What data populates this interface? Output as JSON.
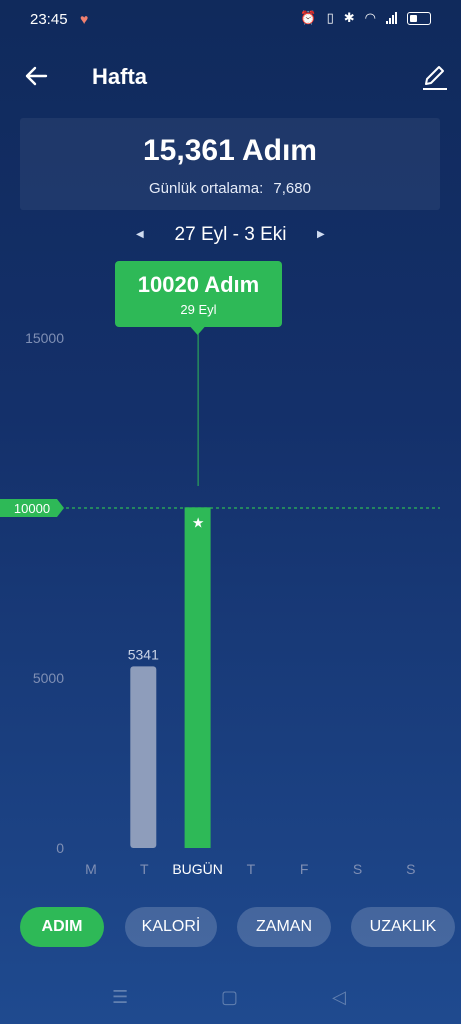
{
  "status_bar": {
    "time": "23:45",
    "battery_pct": 35
  },
  "header": {
    "title": "Hafta"
  },
  "summary": {
    "total": "15,361 Adım",
    "average_label": "Günlük ortalama:",
    "average_value": "7,680"
  },
  "range": {
    "label": "27 Eyl - 3 Eki"
  },
  "tooltip": {
    "value": "10020 Adım",
    "date": "29 Eyl"
  },
  "goal": {
    "label": "10000"
  },
  "chart_data": {
    "type": "bar",
    "categories": [
      "M",
      "T",
      "BUGÜN",
      "T",
      "F",
      "S",
      "S"
    ],
    "values": [
      0,
      5341,
      10020,
      0,
      0,
      0,
      0
    ],
    "data_labels": [
      "",
      "5341",
      "",
      "",
      "",
      "",
      ""
    ],
    "y_ticks": [
      "0",
      "5000",
      "10000",
      "15000"
    ],
    "ylim": [
      0,
      15000
    ],
    "goal": 10000,
    "highlight_index": 2,
    "colors": {
      "normal": "#8e9dbb",
      "highlight": "#2eb957",
      "goal_line": "#2eb957",
      "tick": "#7f8fb4"
    }
  },
  "tabs": [
    {
      "label": "ADIM",
      "active": true
    },
    {
      "label": "KALORİ",
      "active": false
    },
    {
      "label": "ZAMAN",
      "active": false
    },
    {
      "label": "UZAKLIK",
      "active": false
    }
  ]
}
